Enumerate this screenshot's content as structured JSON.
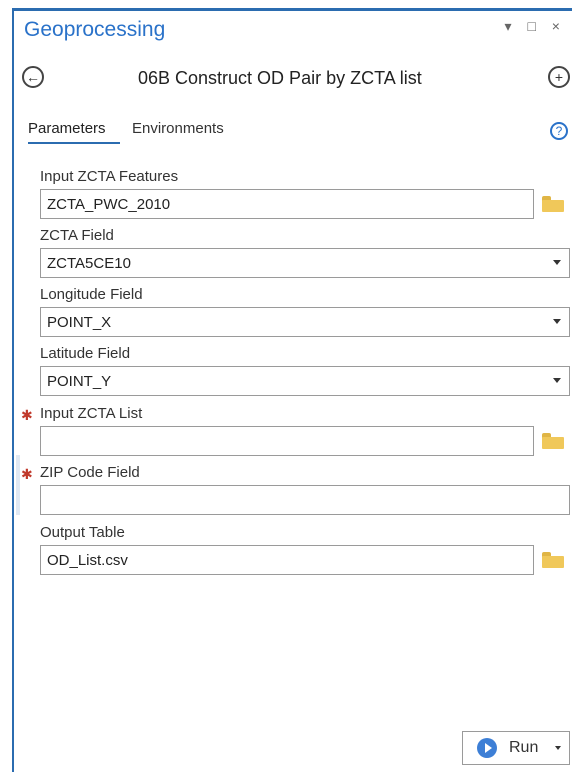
{
  "pane": {
    "title": "Geoprocessing",
    "window_controls": "▾ □ ×"
  },
  "tool": {
    "name": "06B Construct OD Pair by ZCTA list",
    "back_icon": "back-arrow-icon",
    "add_icon": "add-icon"
  },
  "tabs": {
    "parameters": "Parameters",
    "environments": "Environments",
    "help": "?"
  },
  "params": [
    {
      "label": "Input ZCTA Features",
      "value": "ZCTA_PWC_2010",
      "required": false,
      "type": "folder"
    },
    {
      "label": "ZCTA Field",
      "value": "ZCTA5CE10",
      "required": false,
      "type": "dropdown"
    },
    {
      "label": "Longitude Field",
      "value": "POINT_X",
      "required": false,
      "type": "dropdown"
    },
    {
      "label": "Latitude Field",
      "value": "POINT_Y",
      "required": false,
      "type": "dropdown"
    },
    {
      "label": "Input ZCTA List",
      "value": "",
      "required": true,
      "type": "folder"
    },
    {
      "label": "ZIP Code Field",
      "value": "",
      "required": true,
      "type": "text"
    },
    {
      "label": "Output Table",
      "value": "OD_List.csv",
      "required": false,
      "type": "folder"
    }
  ],
  "run": {
    "label": "Run"
  },
  "colors": {
    "accent": "#2b6cb0",
    "title": "#2a72c9",
    "required": "#c0392b",
    "folder": "#f0c85a"
  }
}
